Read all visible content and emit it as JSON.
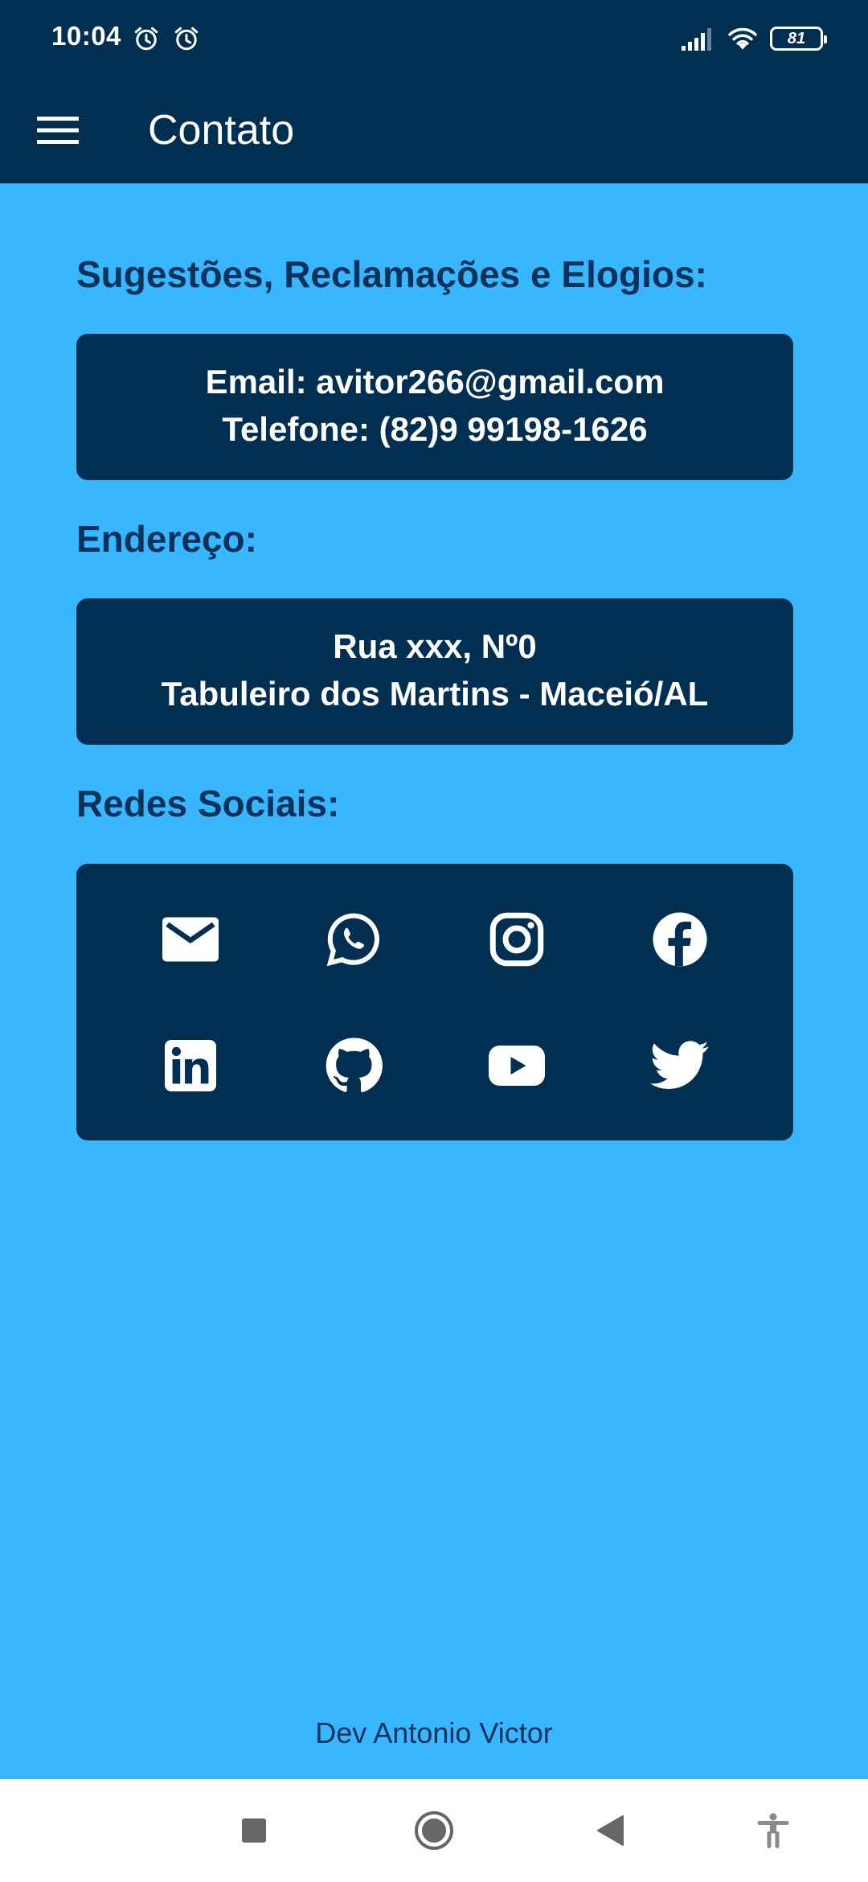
{
  "status_bar": {
    "time": "10:04",
    "battery": "81"
  },
  "app_bar": {
    "title": "Contato",
    "menu_icon": "menu-icon"
  },
  "sections": {
    "suggestions": {
      "heading": "Sugestões, Reclamações e Elogios:",
      "email": "Email: avitor266@gmail.com",
      "phone": "Telefone: (82)9 99198-1626"
    },
    "address": {
      "heading": "Endereço:",
      "line1": "Rua xxx, Nº0",
      "line2": "Tabuleiro dos Martins - Maceió/AL"
    },
    "social": {
      "heading": "Redes Sociais:",
      "icons": [
        "email-icon",
        "whatsapp-icon",
        "instagram-icon",
        "facebook-icon",
        "linkedin-icon",
        "github-icon",
        "youtube-icon",
        "twitter-icon"
      ]
    }
  },
  "footer": {
    "credit": "Dev Antonio Victor"
  },
  "nav_bar": {
    "icons": [
      "recents-icon",
      "home-icon",
      "back-icon",
      "accessibility-icon"
    ]
  },
  "colors": {
    "background": "#38b6ff",
    "primary_dark": "#012f51",
    "heading_text": "#08325a",
    "on_dark_text": "#ffffff"
  }
}
